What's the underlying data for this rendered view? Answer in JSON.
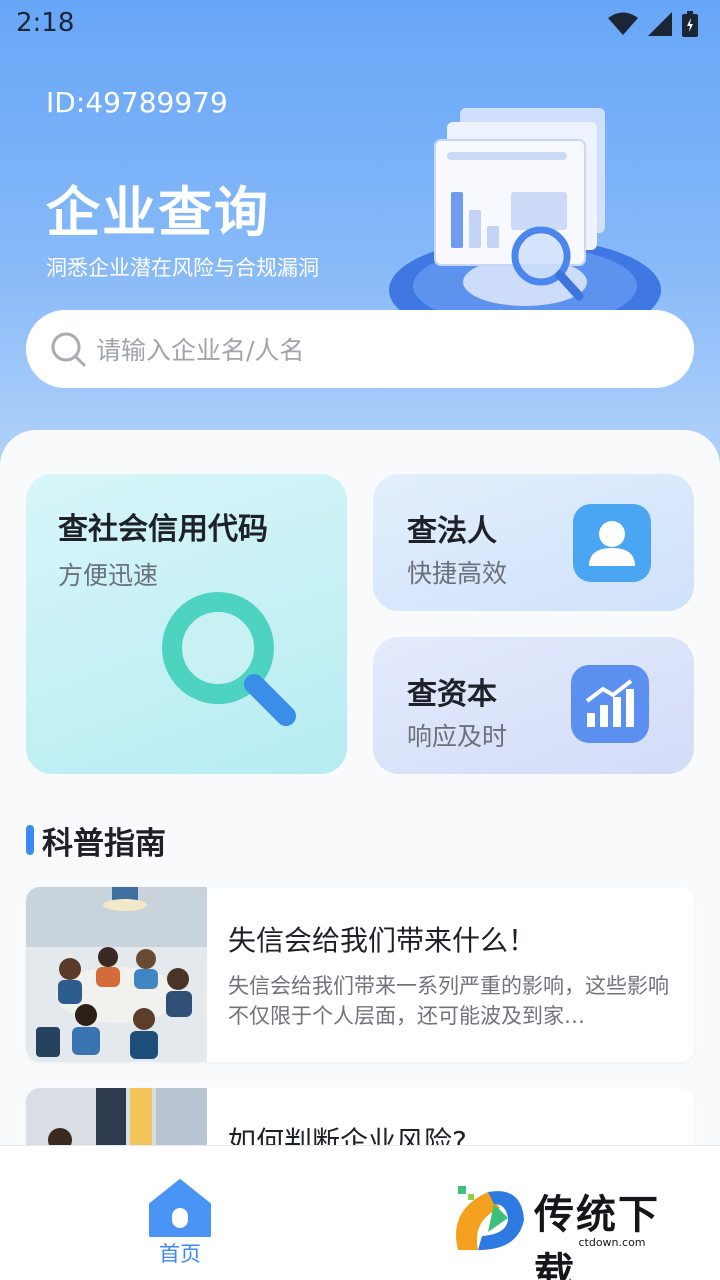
{
  "status_bar": {
    "time": "2:18"
  },
  "hero": {
    "id_label": "ID:49789979",
    "title": "企业查询",
    "subtitle": "洞悉企业潜在风险与合规漏洞"
  },
  "search": {
    "placeholder": "请输入企业名/人名"
  },
  "features": [
    {
      "title": "查社会信用代码",
      "subtitle": "方便迅速"
    },
    {
      "title": "查法人",
      "subtitle": "快捷高效"
    },
    {
      "title": "查资本",
      "subtitle": "响应及时"
    }
  ],
  "guide": {
    "title": "科普指南",
    "articles": [
      {
        "title": "失信会给我们带来什么！",
        "description": "失信会给我们带来一系列严重的影响，这些影响不仅限于个人层面，还可能波及到家…"
      },
      {
        "title": "如何判断企业风险?",
        "description": ""
      }
    ]
  },
  "bottom_nav": {
    "home_label": "首页"
  },
  "watermark": {
    "text": "传统下载",
    "url": "ctdown.com"
  },
  "colors": {
    "accent": "#3b8af5",
    "hero_top": "#67a6f7",
    "hero_bottom": "#b3d2fb"
  }
}
